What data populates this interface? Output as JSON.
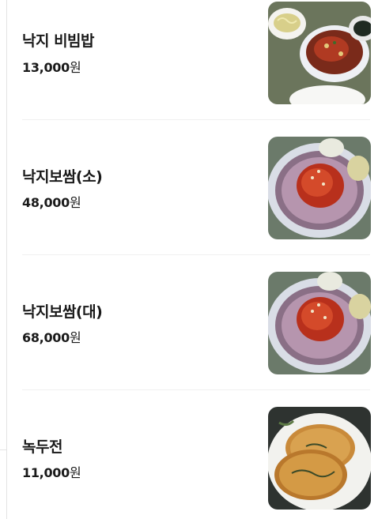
{
  "menu": {
    "items": [
      {
        "name": "낙지 비빔밥",
        "price": "13,000",
        "unit": "원",
        "image": "nakji-bibimbap-photo"
      },
      {
        "name": "낙지보쌈(소)",
        "price": "48,000",
        "unit": "원",
        "image": "nakji-bossam-photo"
      },
      {
        "name": "낙지보쌈(대)",
        "price": "68,000",
        "unit": "원",
        "image": "nakji-bossam-photo"
      },
      {
        "name": "녹두전",
        "price": "11,000",
        "unit": "원",
        "image": "nokdujeon-photo"
      }
    ]
  }
}
